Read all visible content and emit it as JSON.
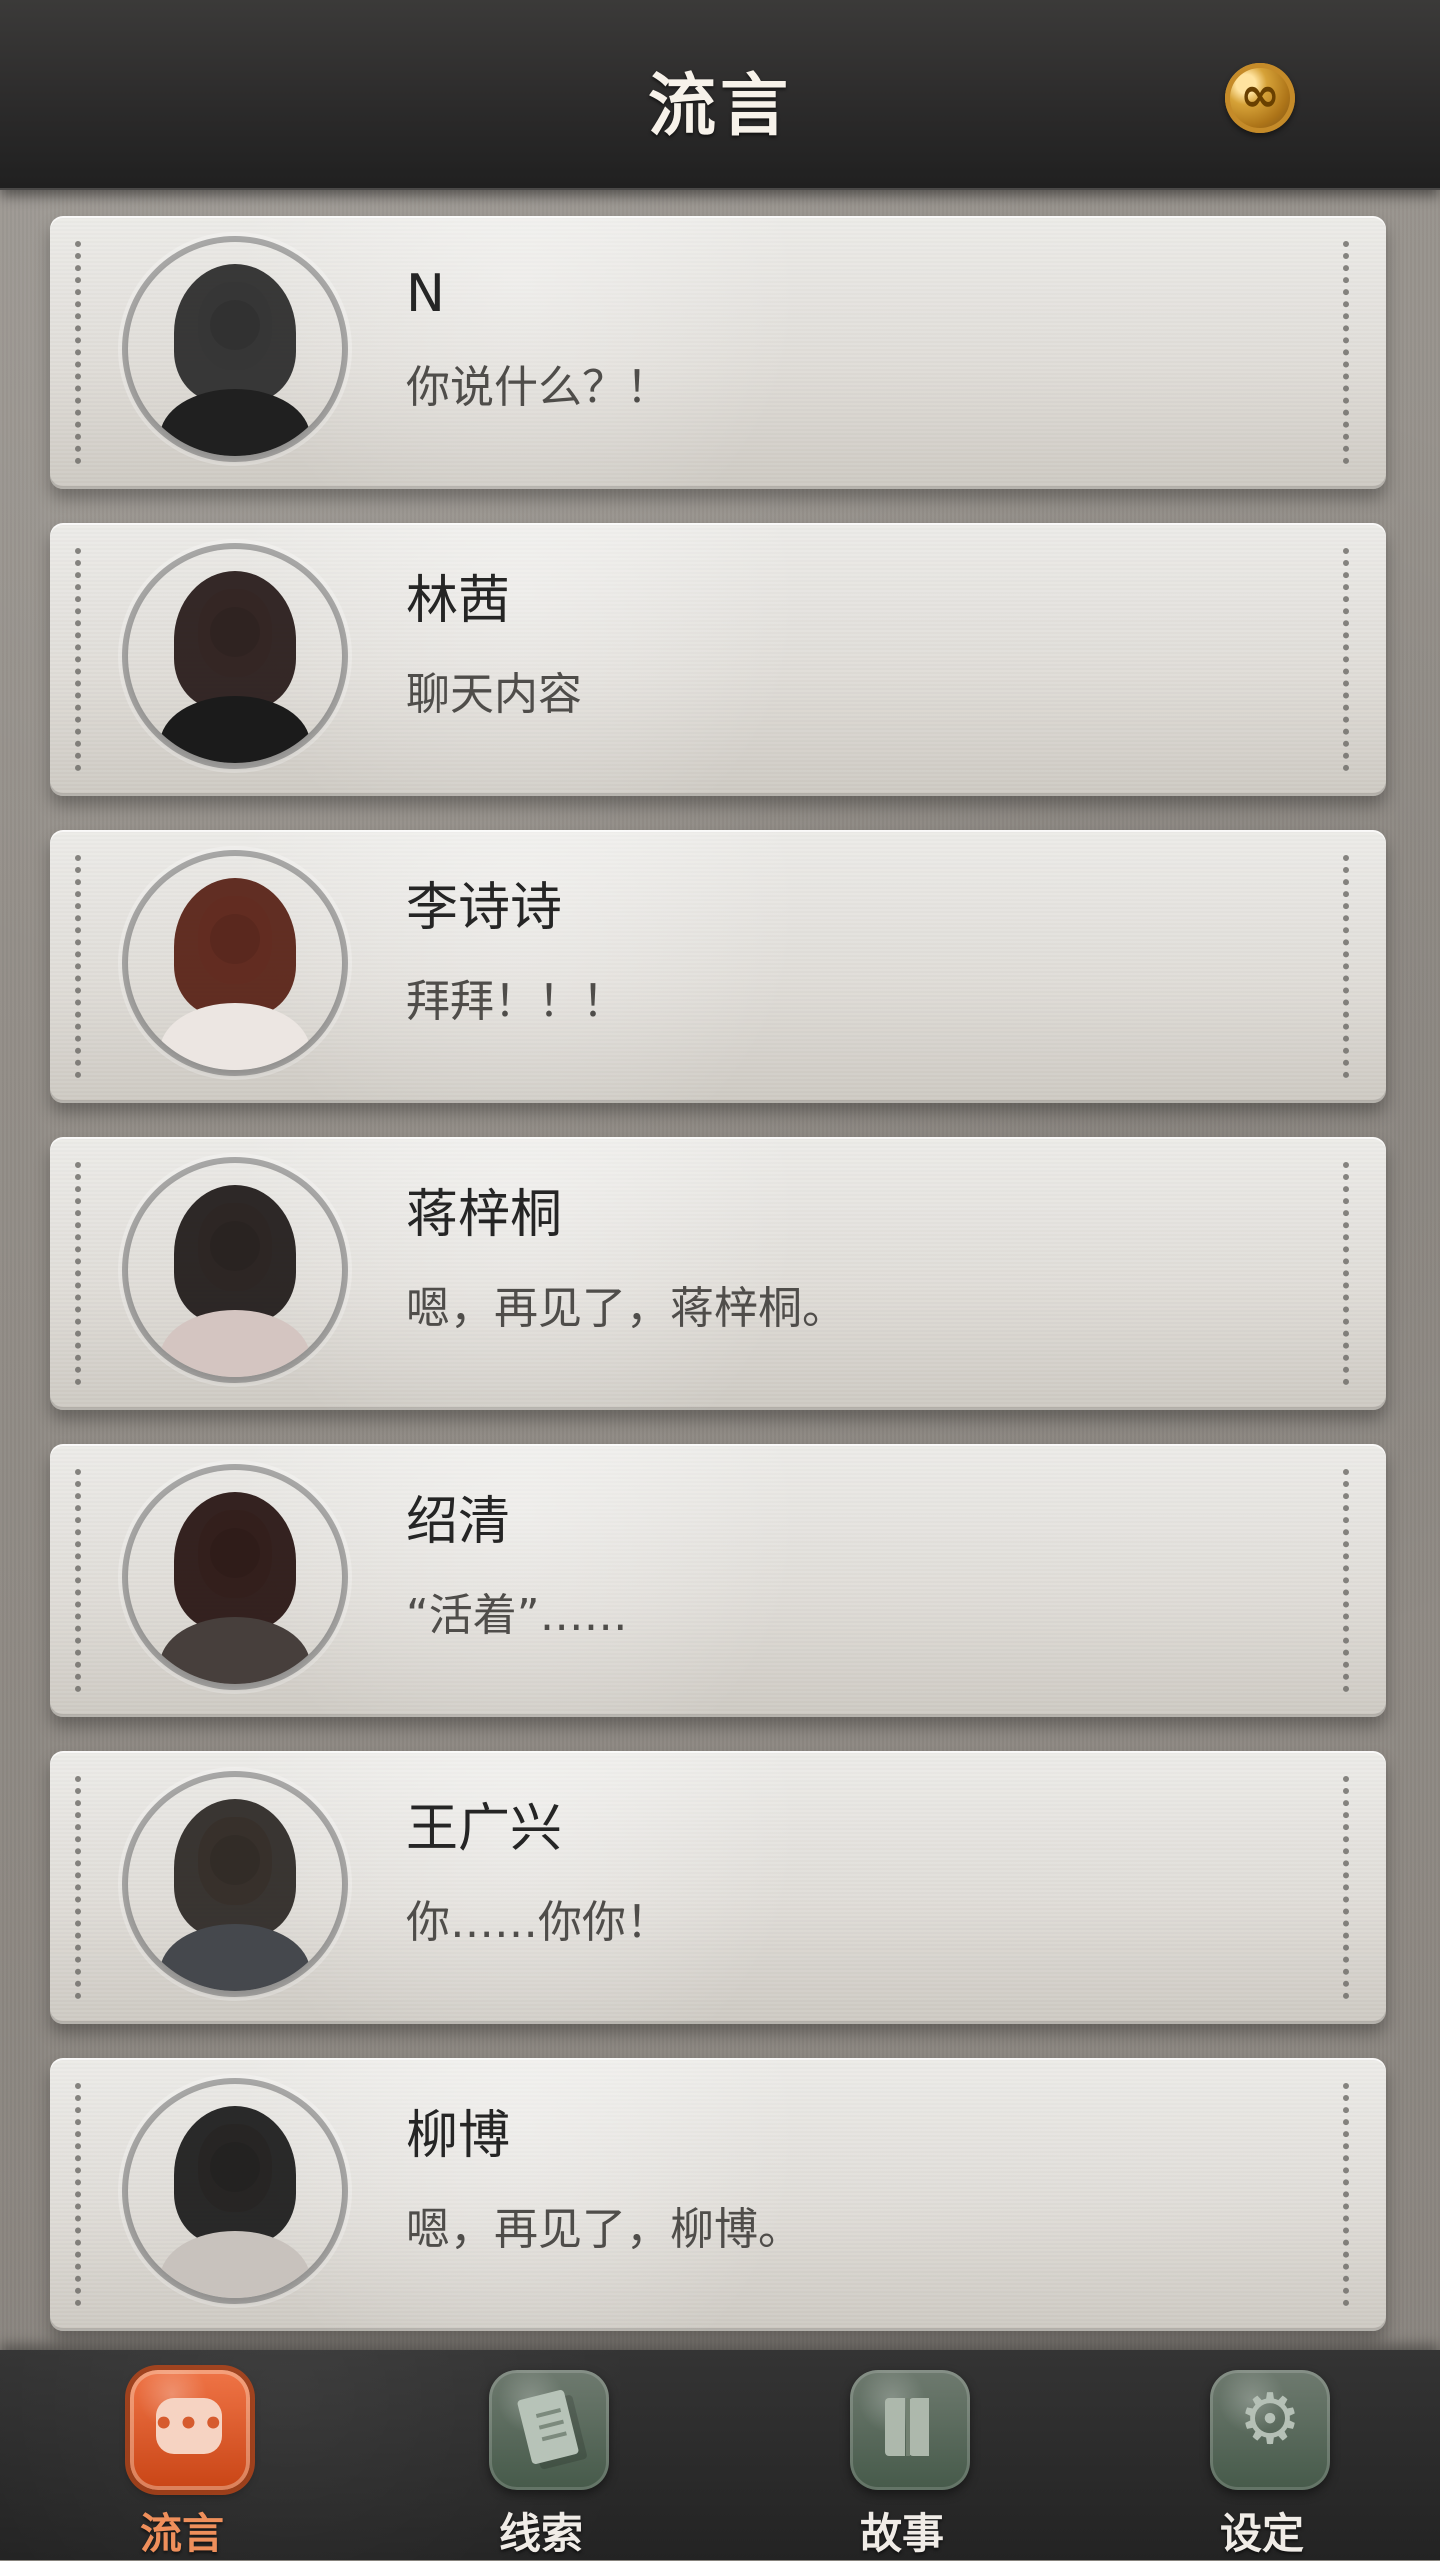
{
  "header": {
    "title": "流言",
    "currency_icon": "infinity-coin-icon"
  },
  "conversations": [
    {
      "name": "N",
      "message": "你说什么？！",
      "avatar_icon": "contact-avatar-icon"
    },
    {
      "name": "林茜",
      "message": "聊天内容",
      "avatar_icon": "contact-avatar-icon"
    },
    {
      "name": "李诗诗",
      "message": "拜拜！！！",
      "avatar_icon": "contact-avatar-icon"
    },
    {
      "name": "蒋梓桐",
      "message": "嗯，再见了，蒋梓桐。",
      "avatar_icon": "contact-avatar-icon"
    },
    {
      "name": "绍清",
      "message": "“活着”……",
      "avatar_icon": "contact-avatar-icon"
    },
    {
      "name": "王广兴",
      "message": "你……你你！",
      "avatar_icon": "contact-avatar-icon"
    },
    {
      "name": "柳博",
      "message": "嗯，再见了，柳博。",
      "avatar_icon": "contact-avatar-icon"
    }
  ],
  "bottom_nav": [
    {
      "label": "流言",
      "icon": "chat-icon",
      "active": true
    },
    {
      "label": "线索",
      "icon": "document-icon",
      "active": false
    },
    {
      "label": "故事",
      "icon": "book-icon",
      "active": false
    },
    {
      "label": "设定",
      "icon": "gear-icon",
      "active": false
    }
  ],
  "colors": {
    "header_bg": "#2c2b2b",
    "card_bg": "#e3e0dc",
    "active_tab": "#d9542a",
    "inactive_tab": "#536b56",
    "title_text": "#f7f2ea"
  }
}
